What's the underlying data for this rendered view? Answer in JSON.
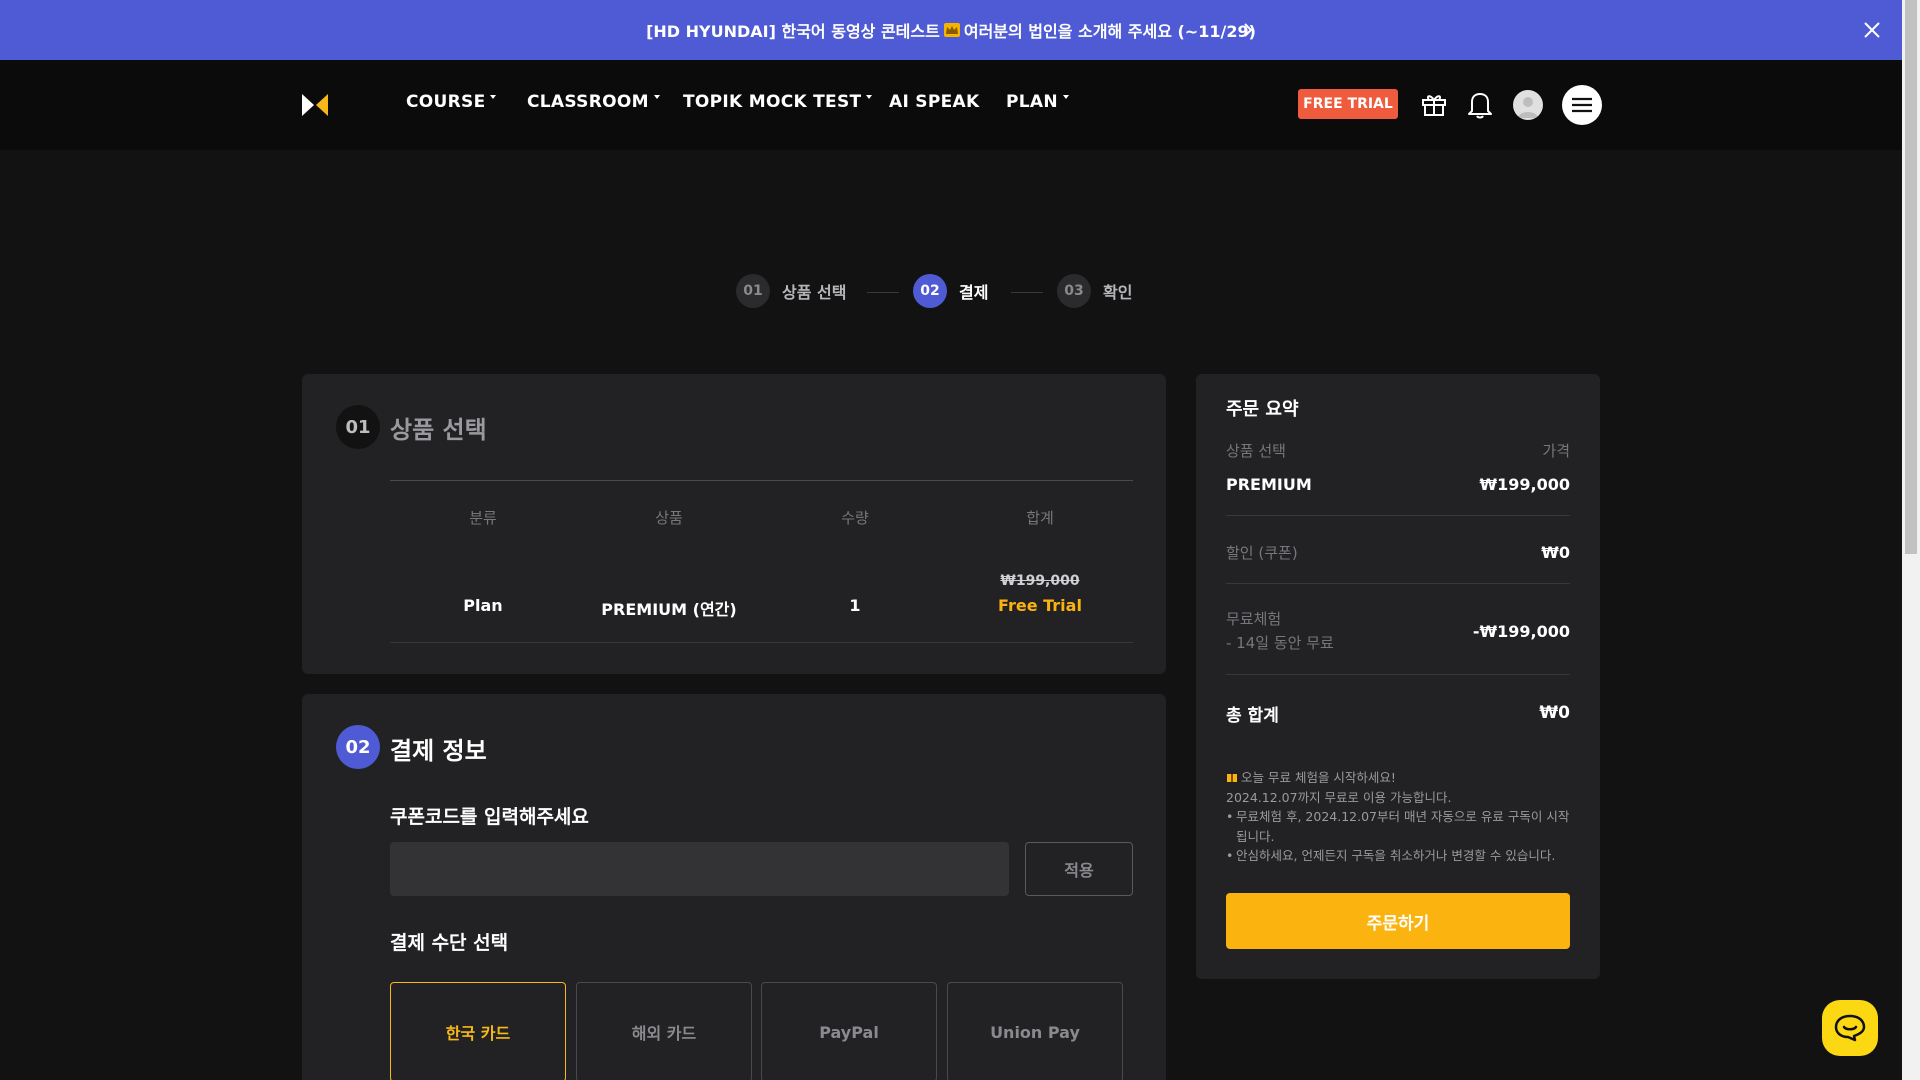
{
  "banner": {
    "text_before": "[HD HYUNDAI] 한국어 동영상 콘테스트",
    "crown_icon": "crown-icon",
    "text_after": "여러분의 법인을 소개해 주세요 (~11/29)",
    "bg_color": "#4f5bd5"
  },
  "nav": {
    "items": [
      {
        "label": "COURSE",
        "dropdown": true
      },
      {
        "label": "CLASSROOM",
        "dropdown": true
      },
      {
        "label": "TOPIK MOCK TEST",
        "dropdown": true
      },
      {
        "label": "AI SPEAK",
        "dropdown": false
      },
      {
        "label": "PLAN",
        "dropdown": true
      }
    ],
    "free_trial_label": "FREE TRIAL",
    "free_trial_color": "#ef5b3d"
  },
  "stepper": {
    "steps": [
      {
        "num": "01",
        "label": "상품 선택",
        "active": false
      },
      {
        "num": "02",
        "label": "결제",
        "active": true
      },
      {
        "num": "03",
        "label": "확인",
        "active": false
      }
    ]
  },
  "product_section": {
    "num": "01",
    "title": "상품 선택",
    "headers": [
      "분류",
      "상품",
      "수량",
      "합계"
    ],
    "row": {
      "category": "Plan",
      "product": "PREMIUM (연간)",
      "quantity": "1",
      "original_price": "₩199,000",
      "price_label": "Free Trial"
    }
  },
  "payment_section": {
    "num": "02",
    "title": "결제 정보",
    "coupon_label": "쿠폰코드를 입력해주세요",
    "coupon_value": "",
    "apply_label": "적용",
    "method_label": "결제 수단 선택",
    "methods": [
      {
        "label": "한국 카드",
        "selected": true
      },
      {
        "label": "해외 카드",
        "selected": false
      },
      {
        "label": "PayPal",
        "selected": false
      },
      {
        "label": "Union Pay",
        "selected": false
      }
    ]
  },
  "summary": {
    "title": "주문 요약",
    "col_product": "상품 선택",
    "col_price": "가격",
    "product_name": "PREMIUM",
    "product_price": "₩199,000",
    "discount_label": "할인 (쿠폰)",
    "discount_value": "₩0",
    "trial_label_line1": "무료체험",
    "trial_label_line2": "- 14일 동안 무료",
    "trial_value": "-₩199,000",
    "total_label": "총 합계",
    "total_value": "₩0",
    "notice": {
      "headline": "오늘 무료 체험을 시작하세요!",
      "line2": "2024.12.07까지 무료로 이용 가능합니다.",
      "bullet1": "무료체험 후, 2024.12.07부터 매년 자동으로 유료 구독이 시작됩니다.",
      "bullet2": "안심하세요, 언제든지 구독을 취소하거나 변경할 수 있습니다."
    },
    "order_label": "주문하기",
    "accent_color": "#fbb40f"
  }
}
